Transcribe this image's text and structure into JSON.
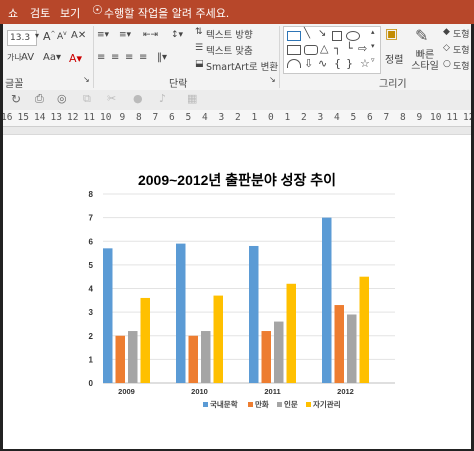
{
  "window": {
    "tabs": [
      "쇼",
      "검토",
      "보기"
    ],
    "tell_me": "수행할 작업을 알려 주세요."
  },
  "ribbon": {
    "font": {
      "size_value": "13.3",
      "group_label": "글꼴"
    },
    "paragraph": {
      "text_direction": "텍스트 방향",
      "align_text": "텍스트 맞춤",
      "smartart": "SmartArt로 변환",
      "group_label": "단락"
    },
    "drawing": {
      "arrange": "정렬",
      "quick_styles": "빠른 스타일",
      "group_label": "그리기",
      "side_label_1": "도형",
      "side_label_2": "도형",
      "side_label_3": "도형"
    }
  },
  "ruler": {
    "marks": [
      "16",
      "15",
      "14",
      "13",
      "12",
      "11",
      "10",
      "9",
      "8",
      "7",
      "6",
      "5",
      "4",
      "3",
      "2",
      "1",
      "0",
      "1",
      "2",
      "3",
      "4",
      "5",
      "6",
      "7",
      "8",
      "9",
      "10",
      "11",
      "12"
    ]
  },
  "colors": {
    "accent": "#b7472a",
    "series": [
      "#5b9bd5",
      "#ed7d31",
      "#a5a5a5",
      "#ffc000"
    ]
  },
  "chart_data": {
    "type": "bar",
    "title": "2009~2012년 출판분야  성장 추이",
    "categories": [
      "2009",
      "2010",
      "2011",
      "2012"
    ],
    "series": [
      {
        "name": "국내문학",
        "values": [
          5.7,
          5.9,
          5.8,
          7.0
        ]
      },
      {
        "name": "만화",
        "values": [
          2.0,
          2.0,
          2.2,
          3.3
        ]
      },
      {
        "name": "인문",
        "values": [
          2.2,
          2.2,
          2.6,
          2.9
        ]
      },
      {
        "name": "자기관리",
        "values": [
          3.6,
          3.7,
          4.2,
          4.5
        ]
      }
    ],
    "yticks": [
      "0",
      "1",
      "2",
      "3",
      "4",
      "5",
      "6",
      "7",
      "8"
    ],
    "ylim": [
      0,
      8
    ],
    "grid": true,
    "legend": "bottom"
  }
}
